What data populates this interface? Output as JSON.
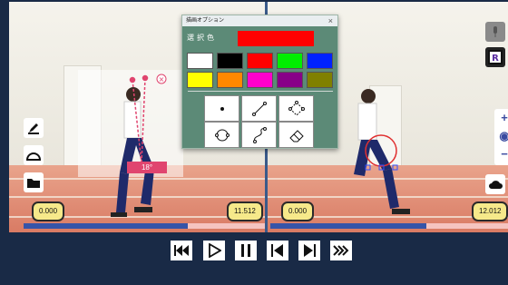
{
  "dialog": {
    "title": "描画オプション",
    "close_label": "×",
    "selected_color_label": "選択色",
    "selected_color": "#ff0000",
    "swatches": [
      "#ffffff",
      "#000000",
      "#ff0000",
      "#00ee00",
      "#0022ff",
      "#ffff00",
      "#ff8800",
      "#ff00cc",
      "#880088",
      "#808000"
    ],
    "tools": [
      "dot-tool",
      "line-tool",
      "polygon-tool",
      "circle-tool",
      "curve-tool",
      "eraser-tool"
    ]
  },
  "left_player": {
    "start_time": "0.000",
    "end_time": "11.512",
    "angle": "18°",
    "progress": 0.68
  },
  "right_player": {
    "start_time": "0.000",
    "end_time": "12.012",
    "progress": 0.65
  },
  "zoom": {
    "plus": "+",
    "center": "◉",
    "minus": "−"
  },
  "controls": [
    "skip-back",
    "play",
    "pause",
    "step-back",
    "step-forward",
    "fast-forward"
  ]
}
